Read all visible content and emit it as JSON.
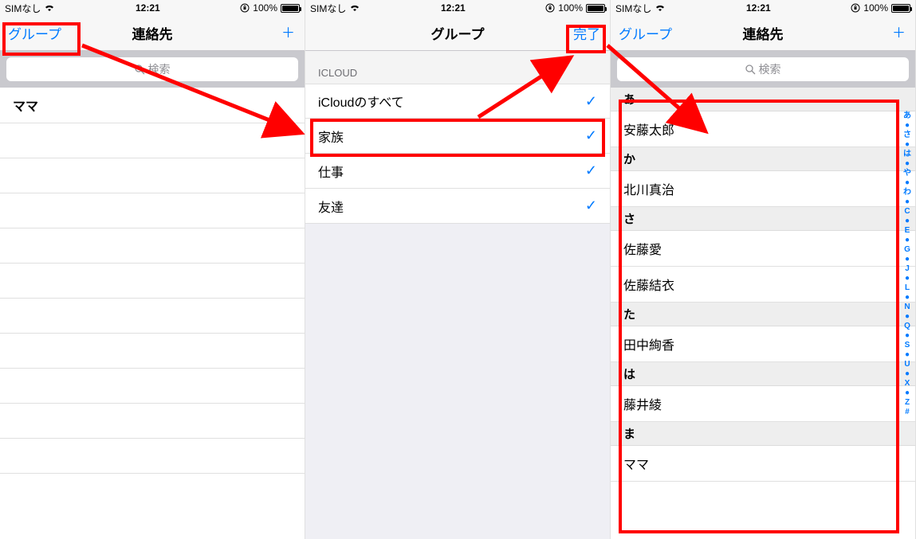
{
  "statusbar": {
    "carrier": "SIMなし",
    "time": "12:21",
    "battery_pct": "100%"
  },
  "screen1": {
    "nav_left": "グループ",
    "nav_title": "連絡先",
    "search_placeholder": "検索",
    "contacts": [
      "ママ"
    ]
  },
  "screen2": {
    "nav_title": "グループ",
    "nav_right": "完了",
    "section_label": "ICLOUD",
    "groups": [
      {
        "label": "iCloudのすべて",
        "checked": true
      },
      {
        "label": "家族",
        "checked": true
      },
      {
        "label": "仕事",
        "checked": true
      },
      {
        "label": "友達",
        "checked": true
      }
    ]
  },
  "screen3": {
    "nav_left": "グループ",
    "nav_title": "連絡先",
    "search_placeholder": "検索",
    "sections": [
      {
        "letter": "あ",
        "names": [
          "安藤太郎"
        ]
      },
      {
        "letter": "か",
        "names": [
          "北川真治"
        ]
      },
      {
        "letter": "さ",
        "names": [
          "佐藤愛",
          "佐藤結衣"
        ]
      },
      {
        "letter": "た",
        "names": [
          "田中絢香"
        ]
      },
      {
        "letter": "は",
        "names": [
          "藤井綾"
        ]
      },
      {
        "letter": "ま",
        "names": [
          "ママ"
        ]
      }
    ],
    "index_letters": [
      "あ",
      "●",
      "さ",
      "●",
      "は",
      "●",
      "や",
      "●",
      "わ",
      "●",
      "C",
      "●",
      "E",
      "●",
      "G",
      "●",
      "J",
      "●",
      "L",
      "●",
      "N",
      "●",
      "Q",
      "●",
      "S",
      "●",
      "U",
      "●",
      "X",
      "●",
      "Z",
      "#"
    ]
  }
}
